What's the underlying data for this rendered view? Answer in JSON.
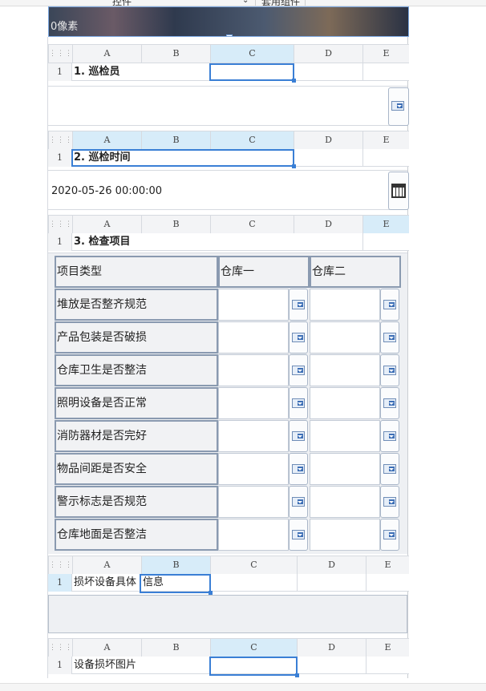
{
  "toolbar": {
    "left_label": "控件",
    "right_label": "套用组件"
  },
  "banner": {
    "pixel_label": "0像素"
  },
  "columns": [
    "A",
    "B",
    "C",
    "D",
    "E"
  ],
  "row_number": "1",
  "sections": {
    "inspector": {
      "title": "1. 巡检员",
      "value": ""
    },
    "inspect_time": {
      "title": "2. 巡检时间",
      "value": "2020-05-26 00:00:00"
    },
    "check_items": {
      "title": "3. 检查项目"
    },
    "damage_info": {
      "title_part1": "损坏设备具体",
      "title_part2": "信息"
    },
    "damage_photo": {
      "title": "设备损坏图片"
    }
  },
  "inspection_table": {
    "header": {
      "type": "项目类型",
      "wh1": "仓库一",
      "wh2": "仓库二"
    },
    "rows": [
      "堆放是否整齐规范",
      "产品包装是否破损",
      "仓库卫生是否整洁",
      "照明设备是否正常",
      "消防器材是否完好",
      "物品间距是否安全",
      "警示标志是否规范",
      "仓库地面是否整洁"
    ]
  },
  "icons": {
    "dropdown": "dropdown-arrow-icon",
    "calendar": "calendar-icon",
    "grip": "grip-dots-icon"
  }
}
